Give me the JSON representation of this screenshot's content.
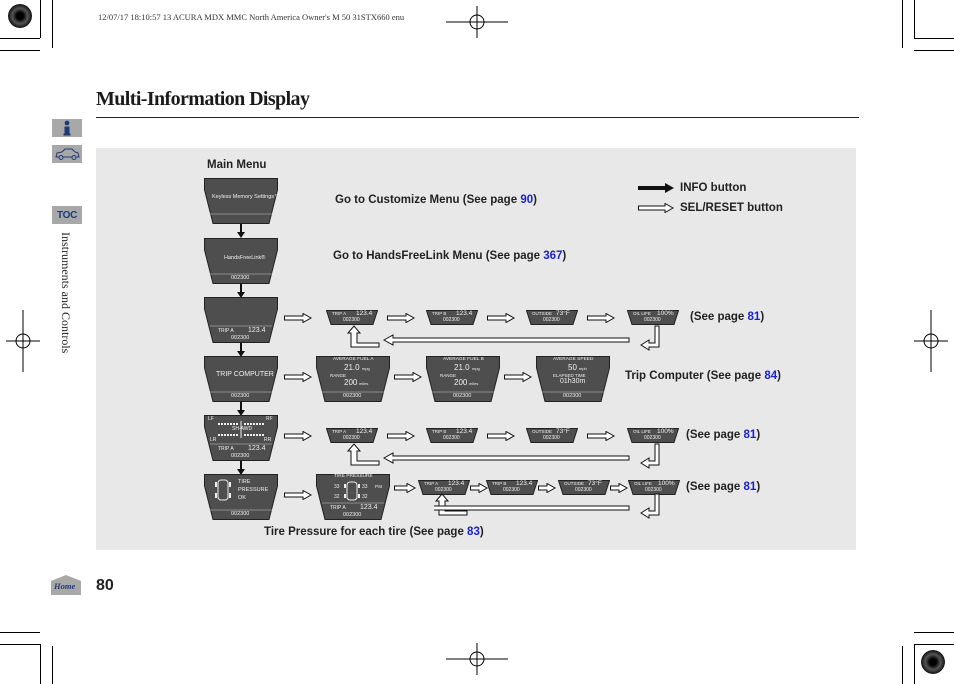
{
  "header": {
    "meta": "12/07/17 18:10:57   13 ACURA MDX MMC North America Owner's M 50 31STX660 enu"
  },
  "page": {
    "title": "Multi-Information Display",
    "section": "Instruments and Controls",
    "number": "80"
  },
  "sidebar": {
    "info_icon": "info-icon",
    "car_icon": "car-icon",
    "toc_label": "TOC",
    "home_label": "Home"
  },
  "diagram": {
    "main_menu": "Main Menu",
    "legend": {
      "info": "INFO button",
      "sel": "SEL/RESET button"
    },
    "captions": {
      "customize": {
        "text": "Go to Customize Menu (See page ",
        "page": "90",
        "end": ")"
      },
      "handsfree": {
        "text": "Go to HandsFreeLink Menu (See page ",
        "page": "367",
        "end": ")"
      },
      "row3": {
        "text": "(See page ",
        "page": "81",
        "end": ")"
      },
      "trip_computer": {
        "text": "Trip Computer (See page ",
        "page": "84",
        "end": ")"
      },
      "row5": {
        "text": "(See page ",
        "page": "81",
        "end": ")"
      },
      "row6": {
        "text": "(See page ",
        "page": "81",
        "end": ")"
      },
      "tire": {
        "text": "Tire Pressure for each tire (See page ",
        "page": "83",
        "end": ")"
      }
    },
    "screens": {
      "keyless": "Keyless Memory Settings™",
      "hfl": "HandsFreeLink®",
      "odo": "002300",
      "trip_a": "TRIP A",
      "trip_b": "TRIP B",
      "trip_val": "123.4",
      "outside": "OUTSIDE",
      "outside_val": "73°F",
      "oil": "OIL LIFE",
      "oil_val": "100%",
      "trip_computer": "TRIP COMPUTER",
      "avg_fuel_a": "AVERAGE FUEL A",
      "avg_fuel_b": "AVERAGE FUEL B",
      "fuel_val": "21.0",
      "fuel_unit": "mpg",
      "range": "RANGE",
      "range_val": "200",
      "range_unit": "miles",
      "avg_speed": "AVERAGE SPEED",
      "speed_val": "50",
      "speed_unit": "mph",
      "elapsed": "ELAPSED TIME",
      "elapsed_val": "01h30m",
      "lf": "LF",
      "rf": "RF",
      "lr": "LR",
      "rr": "RR",
      "awd": "SH-AWD",
      "tire": "TIRE",
      "pressure": "PRESSURE",
      "ok": "OK",
      "tire_pressure": "TIRE PRESSURE",
      "psi_lf": "33",
      "psi_rf": "33",
      "psi_lr": "32",
      "psi_rr": "32",
      "psi": "PSI"
    }
  }
}
